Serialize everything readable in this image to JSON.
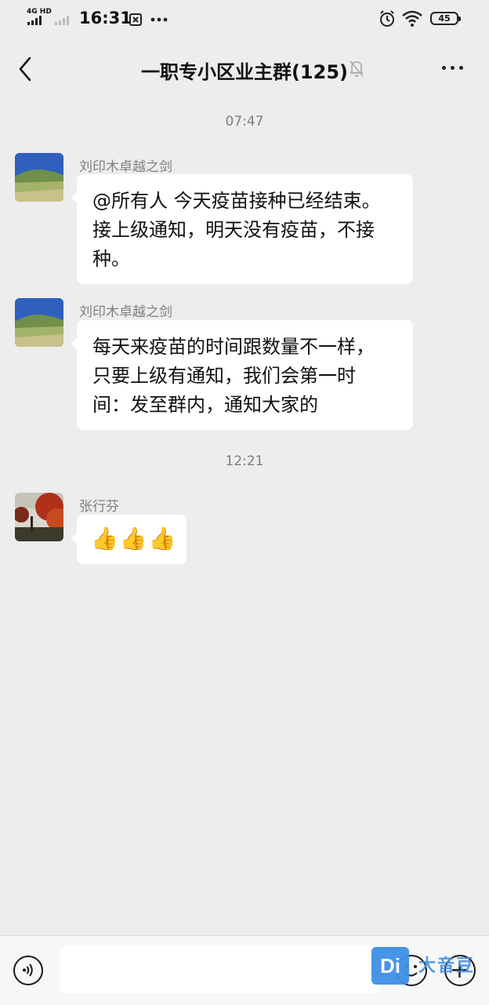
{
  "status_bar": {
    "network": "4G HD",
    "time": "16:31",
    "battery": "45"
  },
  "header": {
    "title": "一职专小区业主群(125)"
  },
  "messages": [
    {
      "type": "timestamp",
      "text": "07:47"
    },
    {
      "type": "text",
      "sender": "刘印木卓越之剑",
      "lines": [
        "@所有人   今天疫苗接种已经结束。",
        "接上级通知，明天没有疫苗，不接",
        "种。"
      ]
    },
    {
      "type": "text",
      "sender": "刘印木卓越之剑",
      "lines": [
        "每天来疫苗的时间跟数量不一样，",
        "只要上级有通知，我们会第一时",
        "间：发至群内，通知大家的"
      ]
    },
    {
      "type": "timestamp",
      "text": "12:21"
    },
    {
      "type": "emoji",
      "sender": "张行芬",
      "emojis": [
        "👍",
        "👍",
        "👍"
      ]
    }
  ],
  "input_bar": {
    "value": ""
  },
  "watermark": {
    "logo": "Di",
    "text": "大音豆"
  },
  "icons": [
    "back-arrow-icon",
    "mute-bell-icon",
    "more-icon",
    "voice-icon",
    "emoji-icon",
    "plus-icon"
  ]
}
